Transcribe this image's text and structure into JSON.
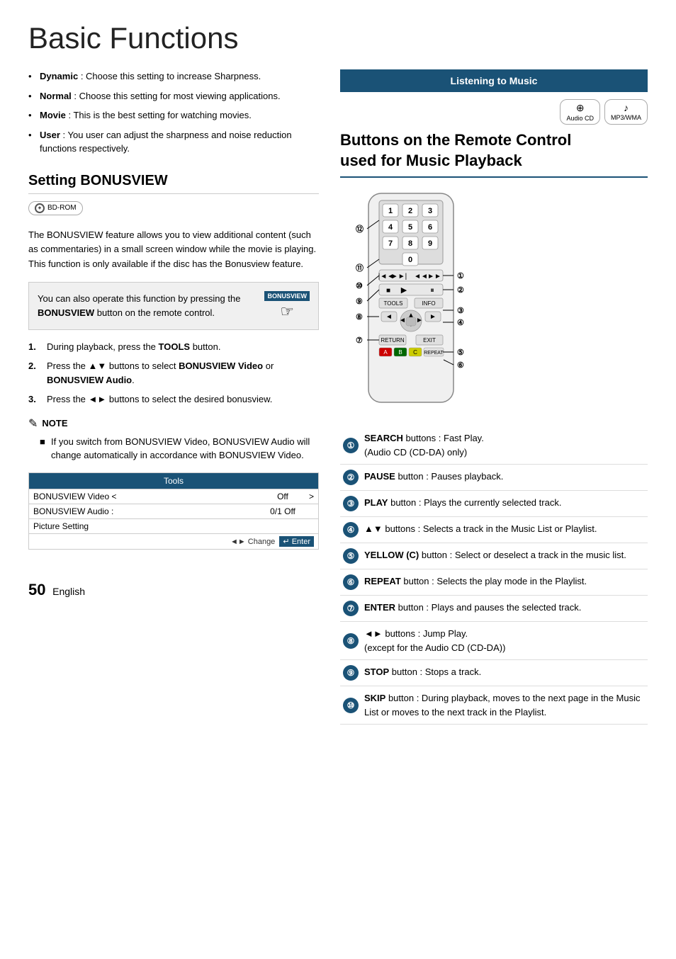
{
  "page": {
    "title": "Basic Functions",
    "page_number": "50",
    "language": "English"
  },
  "left": {
    "bullets": [
      {
        "term": "Dynamic",
        "text": ": Choose this setting to increase Sharpness."
      },
      {
        "term": "Normal",
        "text": ": Choose this setting for most viewing applications."
      },
      {
        "term": "Movie",
        "text": ": This is the best setting for watching movies."
      },
      {
        "term": "User",
        "text": ": You user can adjust the sharpness and noise reduction functions respectively."
      }
    ],
    "setting_section": {
      "title": "Setting BONUSVIEW",
      "badge_label": "BD-ROM",
      "body": "The BONUSVIEW feature allows you to view additional content (such as commentaries) in a small screen window while the movie is playing. This function is only available if the disc has the Bonusview feature.",
      "bonusview_box": {
        "text": "You can also operate this function by pressing the BONUSVIEW button on the remote control.",
        "bold_word": "BONUSVIEW",
        "label": "BONUSVIEW"
      },
      "steps": [
        {
          "num": "1.",
          "text": "During playback, press the TOOLS button."
        },
        {
          "num": "2.",
          "text": "Press the ▲▼ buttons to select BONUSVIEW Video or BONUSVIEW Audio."
        },
        {
          "num": "3.",
          "text": "Press the ◄► buttons to select the desired bonusview."
        }
      ],
      "note": {
        "title": "NOTE",
        "items": [
          "If you switch from BONUSVIEW Video, BONUSVIEW Audio will change automatically in accordance with BONUSVIEW Video."
        ]
      },
      "tools_table": {
        "header": "Tools",
        "rows": [
          {
            "label": "BONUSVIEW Video <",
            "value": "Off",
            "arrow": ">"
          },
          {
            "label": "BONUSVIEW Audio :",
            "value": "0/1 Off",
            "arrow": ""
          },
          {
            "label": "Picture Setting",
            "value": "",
            "arrow": ""
          }
        ],
        "footer": "◄► Change  ↵ Enter"
      }
    }
  },
  "right": {
    "listening_header": "Listening to Music",
    "disc_badges": [
      {
        "icon": "⊕",
        "label": "Audio CD"
      },
      {
        "icon": "♪",
        "label": "MP3/WMA"
      }
    ],
    "buttons_title": "Buttons on the Remote Control used for Music Playback",
    "descriptions": [
      {
        "num": "①",
        "bold": "SEARCH",
        "text": " buttons : Fast Play.\n(Audio CD (CD-DA) only)"
      },
      {
        "num": "②",
        "bold": "PAUSE",
        "text": " button : Pauses playback."
      },
      {
        "num": "③",
        "bold": "PLAY",
        "text": " button : Plays the currently selected track."
      },
      {
        "num": "④",
        "bold": "▲▼",
        "text": " buttons : Selects a track in the Music List or Playlist."
      },
      {
        "num": "⑤",
        "bold": "YELLOW (C)",
        "text": " button : Select or deselect a track in the music list."
      },
      {
        "num": "⑥",
        "bold": "REPEAT",
        "text": " button : Selects the play mode in the Playlist."
      },
      {
        "num": "⑦",
        "bold": "ENTER",
        "text": " button : Plays and pauses the selected track."
      },
      {
        "num": "⑧",
        "bold": "◄►",
        "text": " buttons : Jump Play.\n(except for the Audio CD (CD-DA))"
      },
      {
        "num": "⑨",
        "bold": "STOP",
        "text": " button : Stops a track."
      },
      {
        "num": "⑩",
        "bold": "SKIP",
        "text": " button : During playback, moves to the next page in the Music List or moves to the next track in the Playlist."
      }
    ],
    "remote": {
      "labels": [
        {
          "id": "1",
          "position": "right",
          "arrow": "→",
          "text": "①"
        },
        {
          "id": "2",
          "position": "right",
          "text": "②"
        },
        {
          "id": "3",
          "position": "right",
          "text": "③"
        },
        {
          "id": "4",
          "position": "right",
          "text": "④"
        },
        {
          "id": "5",
          "position": "right",
          "text": "⑤"
        },
        {
          "id": "6",
          "position": "right",
          "text": "⑥"
        },
        {
          "id": "7",
          "position": "left",
          "text": "⑦"
        },
        {
          "id": "8",
          "position": "left",
          "text": "⑧"
        },
        {
          "id": "9",
          "position": "left",
          "text": "⑨"
        },
        {
          "id": "10",
          "position": "left",
          "text": "⑩"
        },
        {
          "id": "11",
          "position": "left",
          "text": "⑪"
        },
        {
          "id": "12",
          "position": "left",
          "text": "⑫"
        }
      ]
    }
  }
}
